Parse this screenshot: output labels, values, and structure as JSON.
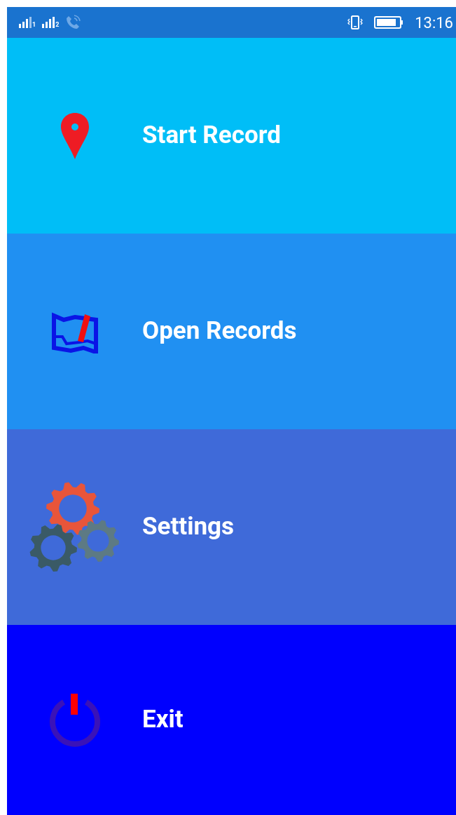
{
  "status_bar": {
    "sims": [
      "1",
      "2"
    ],
    "time": "13:16"
  },
  "menu": [
    {
      "kind": "pin",
      "label": "Start Record",
      "color": "#00bef7"
    },
    {
      "kind": "map",
      "label": "Open Records",
      "color": "#2090f2"
    },
    {
      "kind": "gears",
      "label": "Settings",
      "color": "#3f6ad9"
    },
    {
      "kind": "power",
      "label": "Exit",
      "color": "#0000fe"
    }
  ]
}
